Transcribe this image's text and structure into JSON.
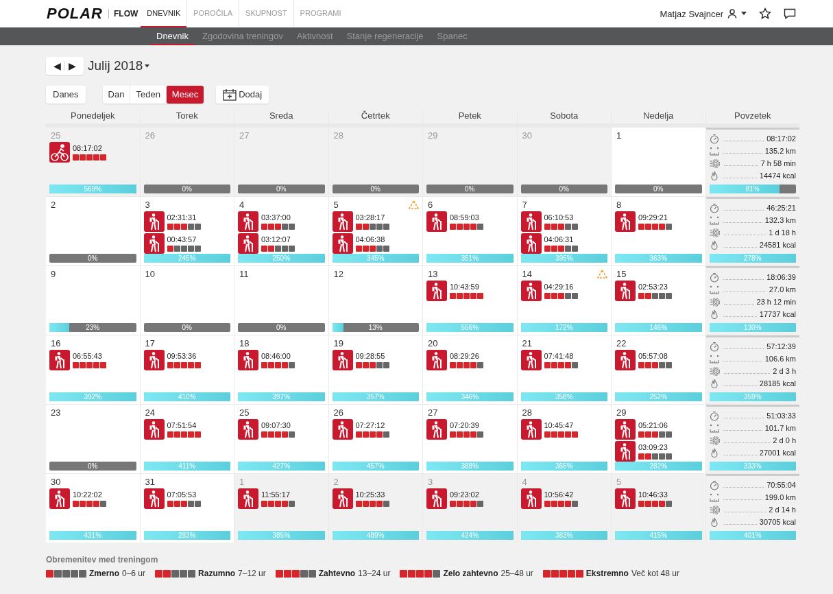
{
  "header": {
    "logo": "POLAR",
    "product": "FLOW",
    "nav": [
      {
        "label": "DNEVNIK",
        "selected": true
      },
      {
        "label": "POROČILA",
        "selected": false
      },
      {
        "label": "SKUPNOST",
        "selected": false
      },
      {
        "label": "PROGRAMI",
        "selected": false
      }
    ],
    "user": "Matjaz Svajncer"
  },
  "subnav": [
    {
      "label": "Dnevnik",
      "selected": true
    },
    {
      "label": "Zgodovina treningov",
      "selected": false
    },
    {
      "label": "Aktivnost",
      "selected": false
    },
    {
      "label": "Stanje regeneracije",
      "selected": false
    },
    {
      "label": "Spanec",
      "selected": false
    }
  ],
  "month_nav": {
    "prev": "◀",
    "next": "▶",
    "month": "Julij 2018"
  },
  "today_button": "Danes",
  "views": [
    {
      "label": "Dan",
      "selected": false
    },
    {
      "label": "Teden",
      "selected": false
    },
    {
      "label": "Mesec",
      "selected": true
    }
  ],
  "add_button": "Dodaj",
  "columns": [
    "Ponedeljek",
    "Torek",
    "Sreda",
    "Četrtek",
    "Petek",
    "Sobota",
    "Nedelja",
    "Povzetek"
  ],
  "weeks": [
    {
      "days": [
        {
          "day": "25",
          "outside": true,
          "workouts": [
            {
              "kind": "bike",
              "time": "08:17:02",
              "stars": 5
            }
          ],
          "load": {
            "level": 1,
            "reading": "569%"
          }
        },
        {
          "day": "26",
          "outside": true,
          "load": {
            "level": 0,
            "reading": "0%"
          }
        },
        {
          "day": "27",
          "outside": true,
          "load": {
            "level": 0,
            "reading": "0%"
          }
        },
        {
          "day": "28",
          "outside": true,
          "load": {
            "level": 0,
            "reading": "0%"
          }
        },
        {
          "day": "29",
          "outside": true,
          "load": {
            "level": 0,
            "reading": "0%"
          }
        },
        {
          "day": "30",
          "outside": true,
          "load": {
            "level": 0,
            "reading": "0%"
          }
        },
        {
          "day": "1",
          "outside": false,
          "load": {
            "level": 0,
            "reading": "0%"
          }
        }
      ],
      "summary": {
        "stats": [
          {
            "kind": "duration",
            "value": "08:17:02"
          },
          {
            "kind": "distance",
            "value": "135.2 km"
          },
          {
            "kind": "active",
            "value": "7 h 58 min"
          },
          {
            "kind": "calories",
            "value": "14474 kcal"
          }
        ],
        "load": {
          "level": 0.81,
          "reading": "81%"
        }
      }
    },
    {
      "days": [
        {
          "day": "2",
          "outside": false,
          "load": {
            "level": 0,
            "reading": "0%"
          }
        },
        {
          "day": "3",
          "outside": false,
          "workouts": [
            {
              "kind": "hike",
              "time": "02:31:31",
              "stars": 3
            },
            {
              "kind": "hike",
              "time": "00:43:57",
              "stars": 1
            }
          ],
          "load": {
            "level": 1,
            "reading": "245%"
          }
        },
        {
          "day": "4",
          "outside": false,
          "workouts": [
            {
              "kind": "hike",
              "time": "03:37:00",
              "stars": 3
            },
            {
              "kind": "hike",
              "time": "03:12:07",
              "stars": 2
            }
          ],
          "load": {
            "level": 1,
            "reading": "250%"
          }
        },
        {
          "day": "5",
          "outside": false,
          "warning": true,
          "workouts": [
            {
              "kind": "hike",
              "time": "03:28:17",
              "stars": 2
            },
            {
              "kind": "hike",
              "time": "04:06:38",
              "stars": 3
            }
          ],
          "load": {
            "level": 1,
            "reading": "345%"
          }
        },
        {
          "day": "6",
          "outside": false,
          "workouts": [
            {
              "kind": "hike",
              "time": "08:59:03",
              "stars": 4
            }
          ],
          "load": {
            "level": 1,
            "reading": "351%"
          }
        },
        {
          "day": "7",
          "outside": false,
          "workouts": [
            {
              "kind": "hike",
              "time": "06:10:53",
              "stars": 3
            },
            {
              "kind": "hike",
              "time": "04:06:31",
              "stars": 3
            }
          ],
          "load": {
            "level": 1,
            "reading": "395%"
          }
        },
        {
          "day": "8",
          "outside": false,
          "workouts": [
            {
              "kind": "hike",
              "time": "09:29:21",
              "stars": 4
            }
          ],
          "load": {
            "level": 1,
            "reading": "363%"
          }
        }
      ],
      "summary": {
        "stats": [
          {
            "kind": "duration",
            "value": "46:25:21"
          },
          {
            "kind": "distance",
            "value": "132.3 km"
          },
          {
            "kind": "active",
            "value": "1 d 18 h"
          },
          {
            "kind": "calories",
            "value": "24581 kcal"
          }
        ],
        "load": {
          "level": 1,
          "reading": "278%"
        }
      }
    },
    {
      "days": [
        {
          "day": "9",
          "outside": false,
          "load": {
            "level": 0.23,
            "reading": "23%"
          }
        },
        {
          "day": "10",
          "outside": false,
          "load": {
            "level": 0,
            "reading": "0%"
          }
        },
        {
          "day": "11",
          "outside": false,
          "load": {
            "level": 0,
            "reading": "0%"
          }
        },
        {
          "day": "12",
          "outside": false,
          "load": {
            "level": 0.13,
            "reading": "13%"
          }
        },
        {
          "day": "13",
          "outside": false,
          "workouts": [
            {
              "kind": "hike",
              "time": "10:43:59",
              "stars": 5
            }
          ],
          "load": {
            "level": 1,
            "reading": "556%"
          }
        },
        {
          "day": "14",
          "outside": false,
          "warning": true,
          "workouts": [
            {
              "kind": "hike",
              "time": "04:29:16",
              "stars": 3
            }
          ],
          "load": {
            "level": 1,
            "reading": "172%"
          }
        },
        {
          "day": "15",
          "outside": false,
          "workouts": [
            {
              "kind": "hike",
              "time": "02:53:23",
              "stars": 2
            }
          ],
          "load": {
            "level": 1,
            "reading": "146%"
          }
        }
      ],
      "summary": {
        "stats": [
          {
            "kind": "duration",
            "value": "18:06:39"
          },
          {
            "kind": "distance",
            "value": "27.0 km"
          },
          {
            "kind": "active",
            "value": "23 h 12 min"
          },
          {
            "kind": "calories",
            "value": "17737 kcal"
          }
        ],
        "load": {
          "level": 1,
          "reading": "130%"
        }
      }
    },
    {
      "days": [
        {
          "day": "16",
          "outside": false,
          "workouts": [
            {
              "kind": "hike",
              "time": "06:55:43",
              "stars": 5
            }
          ],
          "load": {
            "level": 1,
            "reading": "392%"
          }
        },
        {
          "day": "17",
          "outside": false,
          "workouts": [
            {
              "kind": "hike",
              "time": "09:53:36",
              "stars": 5
            }
          ],
          "load": {
            "level": 1,
            "reading": "410%"
          }
        },
        {
          "day": "18",
          "outside": false,
          "workouts": [
            {
              "kind": "hike",
              "time": "08:46:00",
              "stars": 4
            }
          ],
          "load": {
            "level": 1,
            "reading": "397%"
          }
        },
        {
          "day": "19",
          "outside": false,
          "workouts": [
            {
              "kind": "hike",
              "time": "09:28:55",
              "stars": 3
            }
          ],
          "load": {
            "level": 1,
            "reading": "357%"
          }
        },
        {
          "day": "20",
          "outside": false,
          "workouts": [
            {
              "kind": "hike",
              "time": "08:29:26",
              "stars": 4
            }
          ],
          "load": {
            "level": 1,
            "reading": "346%"
          }
        },
        {
          "day": "21",
          "outside": false,
          "workouts": [
            {
              "kind": "hike",
              "time": "07:41:48",
              "stars": 4
            }
          ],
          "load": {
            "level": 1,
            "reading": "358%"
          }
        },
        {
          "day": "22",
          "outside": false,
          "workouts": [
            {
              "kind": "hike",
              "time": "05:57:08",
              "stars": 3
            }
          ],
          "load": {
            "level": 1,
            "reading": "252%"
          }
        }
      ],
      "summary": {
        "stats": [
          {
            "kind": "duration",
            "value": "57:12:39"
          },
          {
            "kind": "distance",
            "value": "106.6 km"
          },
          {
            "kind": "active",
            "value": "2 d 3 h"
          },
          {
            "kind": "calories",
            "value": "28185 kcal"
          }
        ],
        "load": {
          "level": 1,
          "reading": "359%"
        }
      }
    },
    {
      "days": [
        {
          "day": "23",
          "outside": false,
          "load": {
            "level": 0,
            "reading": "0%"
          }
        },
        {
          "day": "24",
          "outside": false,
          "workouts": [
            {
              "kind": "hike",
              "time": "07:51:54",
              "stars": 5
            }
          ],
          "load": {
            "level": 1,
            "reading": "411%"
          }
        },
        {
          "day": "25",
          "outside": false,
          "workouts": [
            {
              "kind": "hike",
              "time": "09:07:30",
              "stars": 4
            }
          ],
          "load": {
            "level": 1,
            "reading": "427%"
          }
        },
        {
          "day": "26",
          "outside": false,
          "workouts": [
            {
              "kind": "hike",
              "time": "07:27:12",
              "stars": 4
            }
          ],
          "load": {
            "level": 1,
            "reading": "457%"
          }
        },
        {
          "day": "27",
          "outside": false,
          "workouts": [
            {
              "kind": "hike",
              "time": "07:20:39",
              "stars": 4
            }
          ],
          "load": {
            "level": 1,
            "reading": "388%"
          }
        },
        {
          "day": "28",
          "outside": false,
          "workouts": [
            {
              "kind": "hike",
              "time": "10:45:47",
              "stars": 5
            }
          ],
          "load": {
            "level": 1,
            "reading": "365%"
          }
        },
        {
          "day": "29",
          "outside": false,
          "workouts": [
            {
              "kind": "hike",
              "time": "05:21:06",
              "stars": 3
            },
            {
              "kind": "hike",
              "time": "03:09:23",
              "stars": 2
            }
          ],
          "load": {
            "level": 1,
            "reading": "282%"
          }
        }
      ],
      "summary": {
        "stats": [
          {
            "kind": "duration",
            "value": "51:03:33"
          },
          {
            "kind": "distance",
            "value": "101.7 km"
          },
          {
            "kind": "active",
            "value": "2 d 0 h"
          },
          {
            "kind": "calories",
            "value": "27001 kcal"
          }
        ],
        "load": {
          "level": 1,
          "reading": "333%"
        }
      }
    },
    {
      "days": [
        {
          "day": "30",
          "outside": false,
          "workouts": [
            {
              "kind": "hike",
              "time": "10:22:02",
              "stars": 4
            }
          ],
          "load": {
            "level": 1,
            "reading": "431%"
          }
        },
        {
          "day": "31",
          "outside": false,
          "workouts": [
            {
              "kind": "hike",
              "time": "07:05:53",
              "stars": 3
            }
          ],
          "load": {
            "level": 1,
            "reading": "283%"
          }
        },
        {
          "day": "1",
          "outside": true,
          "workouts": [
            {
              "kind": "hike",
              "time": "11:55:17",
              "stars": 4
            }
          ],
          "load": {
            "level": 1,
            "reading": "385%"
          }
        },
        {
          "day": "2",
          "outside": true,
          "workouts": [
            {
              "kind": "hike",
              "time": "10:25:33",
              "stars": 4
            }
          ],
          "load": {
            "level": 1,
            "reading": "489%"
          }
        },
        {
          "day": "3",
          "outside": true,
          "workouts": [
            {
              "kind": "hike",
              "time": "09:23:02",
              "stars": 4
            }
          ],
          "load": {
            "level": 1,
            "reading": "424%"
          }
        },
        {
          "day": "4",
          "outside": true,
          "workouts": [
            {
              "kind": "hike",
              "time": "10:56:42",
              "stars": 4
            }
          ],
          "load": {
            "level": 1,
            "reading": "383%"
          }
        },
        {
          "day": "5",
          "outside": true,
          "workouts": [
            {
              "kind": "hike",
              "time": "10:46:33",
              "stars": 4
            }
          ],
          "load": {
            "level": 1,
            "reading": "415%"
          }
        }
      ],
      "summary": {
        "stats": [
          {
            "kind": "duration",
            "value": "70:55:04"
          },
          {
            "kind": "distance",
            "value": "199.0 km"
          },
          {
            "kind": "active",
            "value": "2 d 14 h"
          },
          {
            "kind": "calories",
            "value": "30705 kcal"
          }
        ],
        "load": {
          "level": 1,
          "reading": "401%"
        }
      }
    }
  ],
  "legend": {
    "title": "Obremenitev med treningom",
    "items": [
      {
        "stars": 1,
        "name": "Zmerno",
        "range": "0–6 ur"
      },
      {
        "stars": 2,
        "name": "Razumno",
        "range": "7–12 ur"
      },
      {
        "stars": 3,
        "name": "Zahtevno",
        "range": "13–24 ur"
      },
      {
        "stars": 4,
        "name": "Zelo zahtevno",
        "range": "25–48 ur"
      },
      {
        "stars": 5,
        "name": "Ekstremno",
        "range": "Več kot 48 ur"
      }
    ]
  }
}
